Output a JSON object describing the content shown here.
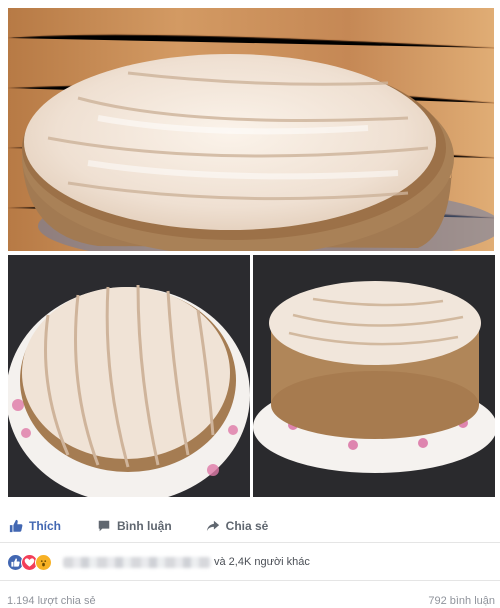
{
  "photos": [
    {
      "name": "cake-top-photo",
      "description_icon": "cake-photo"
    },
    {
      "name": "cake-bottom-left-photo",
      "description_icon": "cake-photo"
    },
    {
      "name": "cake-bottom-right-photo",
      "description_icon": "cake-photo"
    }
  ],
  "actions": {
    "like_label": "Thích",
    "comment_label": "Bình luận",
    "share_label": "Chia sẻ",
    "like_color": "#4267b2",
    "muted_color": "#606770"
  },
  "reactions": {
    "icons": [
      "like-reaction-icon",
      "love-reaction-icon",
      "wow-reaction-icon"
    ],
    "others_text": "và 2,4K người khác"
  },
  "footer": {
    "shares_text": "1.194 lượt chia sẻ",
    "comments_text": "792 bình luận"
  }
}
